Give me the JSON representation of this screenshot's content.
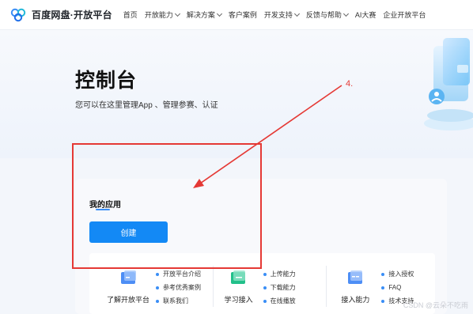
{
  "brand": {
    "name": "百度网盘·开放平台",
    "accent": "#1389f5",
    "annotation_color": "#e53935"
  },
  "nav": {
    "items": [
      {
        "label": "首页",
        "has_dropdown": false
      },
      {
        "label": "开放能力",
        "has_dropdown": true
      },
      {
        "label": "解决方案",
        "has_dropdown": true
      },
      {
        "label": "客户案例",
        "has_dropdown": false
      },
      {
        "label": "开发支持",
        "has_dropdown": true
      },
      {
        "label": "反馈与帮助",
        "has_dropdown": true
      },
      {
        "label": "AI大赛",
        "has_dropdown": false
      },
      {
        "label": "企业开放平台",
        "has_dropdown": false
      }
    ]
  },
  "hero": {
    "title": "控制台",
    "subtitle": "您可以在这里管理App 、管理参赛、认证"
  },
  "apps": {
    "title": "我的应用",
    "create_label": "创建"
  },
  "features": [
    {
      "name": "了解开放平台",
      "icon": "platform-intro-icon",
      "links": [
        "开放平台介绍",
        "参考优秀案例",
        "联系我们"
      ]
    },
    {
      "name": "学习接入",
      "icon": "learn-access-icon",
      "links": [
        "上传能力",
        "下载能力",
        "在线播放"
      ]
    },
    {
      "name": "接入能力",
      "icon": "access-capability-icon",
      "links": [
        "接入授权",
        "FAQ",
        "技术支持"
      ]
    }
  ],
  "annotation": {
    "number": "4."
  },
  "watermark": "CSDN @云朵不吃雨"
}
